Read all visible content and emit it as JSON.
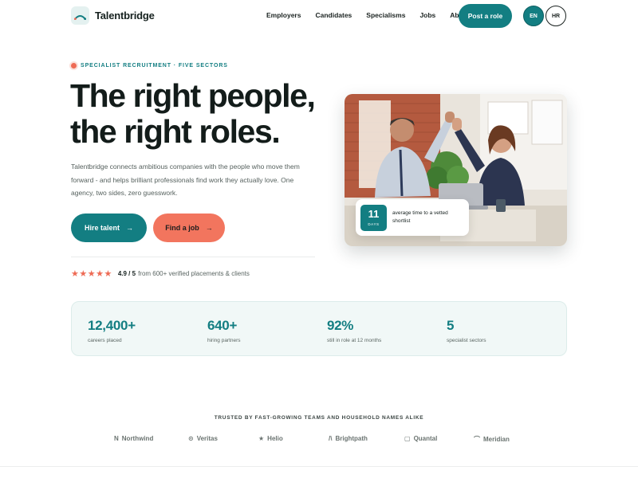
{
  "header": {
    "brand_name": "Talentbridge",
    "logo_icon": "bridge-arc-icon",
    "nav": [
      "Employers",
      "Candidates",
      "Specialisms",
      "Jobs",
      "About"
    ],
    "cta_label": "Post a role",
    "languages": [
      {
        "code": "EN",
        "active": true
      },
      {
        "code": "HR",
        "active": false
      }
    ]
  },
  "hero": {
    "eyebrow": "SPECIALIST RECRUITMENT · FIVE SECTORS",
    "headline_line1": "The right people,",
    "headline_line2": "the right roles.",
    "lead": "Talentbridge connects ambitious companies with the people who move them forward - and helps brilliant professionals find work they actually love. One agency, two sides, zero guesswork.",
    "primary_cta": "Hire talent",
    "secondary_cta": "Find a job",
    "arrow_glyph": "→",
    "rating": {
      "stars": 5,
      "star_glyphs": "★★★★★",
      "score": "4.9 / 5",
      "text": "from 600+ verified placements & clients"
    },
    "photo_badge": {
      "number": "11",
      "unit": "DAYS",
      "text": "average time to a vetted shortlist"
    }
  },
  "stats": [
    {
      "value": "12,400+",
      "label": "careers placed"
    },
    {
      "value": "640+",
      "label": "hiring partners"
    },
    {
      "value": "92%",
      "label": "still in role at 12 months"
    },
    {
      "value": "5",
      "label": "specialist sectors"
    }
  ],
  "trusted": {
    "title": "TRUSTED BY FAST-GROWING TEAMS AND HOUSEHOLD NAMES ALIKE",
    "brands": [
      {
        "name": "Northwind",
        "icon": "n-mark-icon",
        "glyph": "N"
      },
      {
        "name": "Veritas",
        "icon": "circle-check-icon",
        "glyph": "⊙"
      },
      {
        "name": "Helio",
        "icon": "star-icon",
        "glyph": "★"
      },
      {
        "name": "Brightpath",
        "icon": "path-icon",
        "glyph": "/\\"
      },
      {
        "name": "Quantal",
        "icon": "square-icon",
        "glyph": "▢"
      },
      {
        "name": "Meridian",
        "icon": "arc-icon",
        "glyph": "⌒"
      }
    ]
  },
  "colors": {
    "brand_teal": "#137e82",
    "accent_coral": "#f2755e",
    "heading": "#131c1a",
    "stats_bg": "#f1f8f7"
  }
}
